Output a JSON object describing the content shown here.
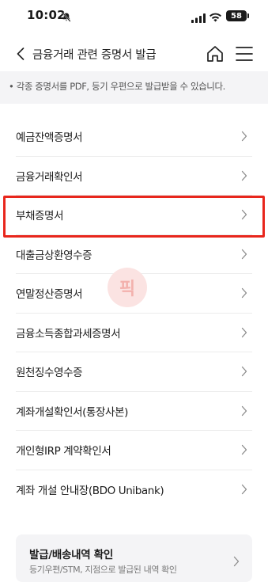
{
  "status_bar": {
    "time": "10:02",
    "battery": "58"
  },
  "header": {
    "title": "금융거래 관련 증명서 발급"
  },
  "notice": {
    "text": "• 각종 증명서를 PDF, 등기 우편으로 발급받을 수 있습니다."
  },
  "list": {
    "items": [
      {
        "label": "예금잔액증명서"
      },
      {
        "label": "금융거래확인서"
      },
      {
        "label": "부채증명서"
      },
      {
        "label": "대출금상환영수증"
      },
      {
        "label": "연말정산증명서"
      },
      {
        "label": "금융소득종합과세증명서"
      },
      {
        "label": "원천징수영수증"
      },
      {
        "label": "계좌개설확인서(통장사본)"
      },
      {
        "label": "개인형IRP 계약확인서"
      },
      {
        "label": "계좌 개설 안내장(BDO Unibank)"
      }
    ]
  },
  "watermark": {
    "text": "픽"
  },
  "card": {
    "title": "발급/배송내역 확인",
    "subtitle": "등기우편/STM, 지점으로 발급된 내역 확인"
  },
  "colors": {
    "highlight": "#e8261c",
    "background_gray": "#f4f4f6"
  }
}
